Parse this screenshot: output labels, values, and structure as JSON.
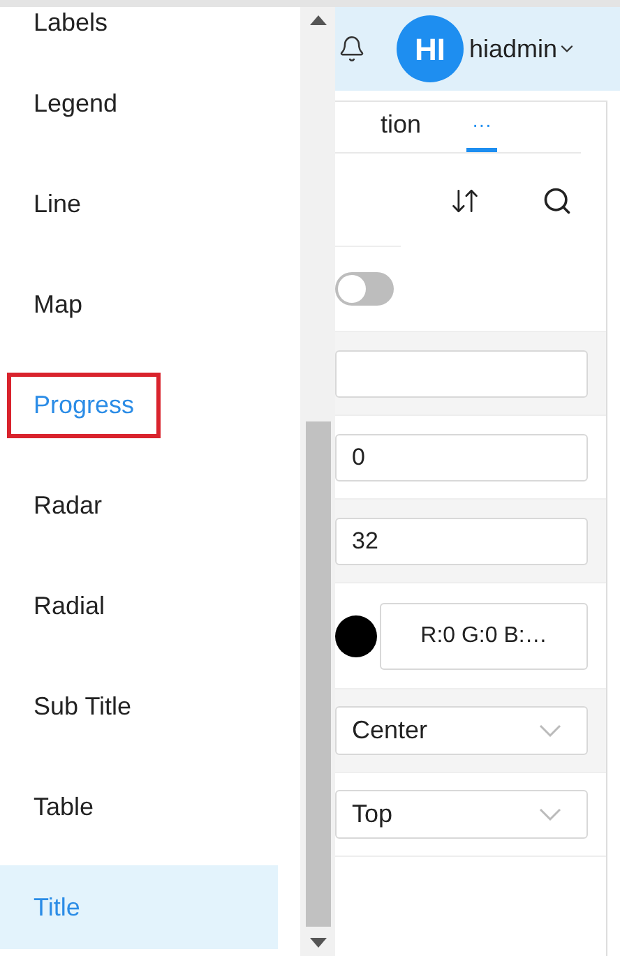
{
  "dropdown": {
    "items": [
      {
        "label": "Labels",
        "selected": false,
        "highlighted": false
      },
      {
        "label": "Legend",
        "selected": false,
        "highlighted": false
      },
      {
        "label": "Line",
        "selected": false,
        "highlighted": false
      },
      {
        "label": "Map",
        "selected": false,
        "highlighted": false
      },
      {
        "label": "Progress",
        "selected": false,
        "highlighted": true
      },
      {
        "label": "Radar",
        "selected": false,
        "highlighted": false
      },
      {
        "label": "Radial",
        "selected": false,
        "highlighted": false
      },
      {
        "label": "Sub Title",
        "selected": false,
        "highlighted": false
      },
      {
        "label": "Table",
        "selected": false,
        "highlighted": false
      },
      {
        "label": "Title",
        "selected": true,
        "highlighted": false
      }
    ]
  },
  "header": {
    "avatar": "HI",
    "user": "hiadmin"
  },
  "tabs": [
    {
      "label": "tion",
      "selected": false
    },
    {
      "label": "···",
      "selected": true
    }
  ],
  "toggle": {
    "on": false
  },
  "fields": [
    {
      "kind": "input"
    },
    {
      "kind": "input",
      "value": "0"
    },
    {
      "kind": "input",
      "value": "32"
    },
    {
      "kind": "color",
      "value": "R:0 G:0 B:…",
      "color": "#000000"
    },
    {
      "kind": "select",
      "value": "Center"
    },
    {
      "kind": "select",
      "value": "Top"
    }
  ]
}
